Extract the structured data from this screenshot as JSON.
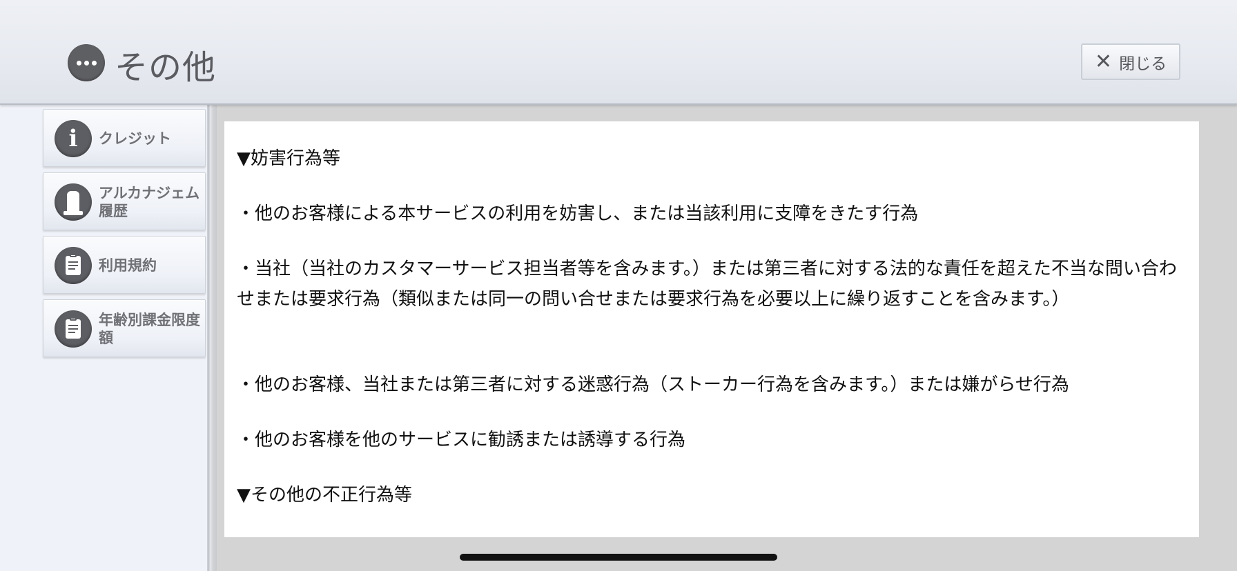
{
  "header": {
    "title": "その他",
    "close_label": "閉じる"
  },
  "sidebar": {
    "items": [
      {
        "label": "クレジット",
        "icon": "info-icon"
      },
      {
        "label": "アルカナジェム履歴",
        "icon": "gem-icon"
      },
      {
        "label": "利用規約",
        "icon": "clipboard-icon"
      },
      {
        "label": "年齢別課金限度額",
        "icon": "clipboard-icon"
      }
    ]
  },
  "content": {
    "lines": [
      "▼妨害行為等",
      "・他のお客様による本サービスの利用を妨害し、または当該利用に支障をきたす行為",
      "・当社（当社のカスタマーサービス担当者等を含みます。）または第三者に対する法的な責任を超えた不当な問い合わせまたは要求行為（類似または同一の問い合せまたは要求行為を必要以上に繰り返すことを含みます。）",
      "・他のお客様、当社または第三者に対する迷惑行為（ストーカー行為を含みます。）または嫌がらせ行為",
      "・他のお客様を他のサービスに勧誘または誘導する行為",
      "▼その他の不正行為等"
    ]
  },
  "colors": {
    "header_bg": "#e7eaf0",
    "icon_bg": "#5d5e63",
    "content_bg": "#ffffff",
    "gutter_bg": "#d4d4d4"
  }
}
